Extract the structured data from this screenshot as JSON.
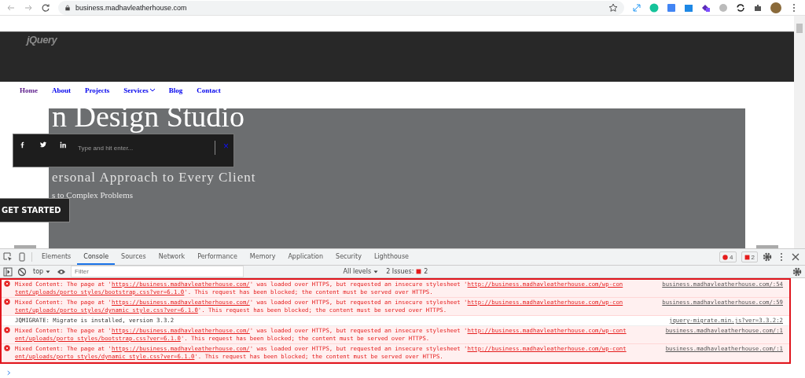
{
  "browser": {
    "url": "business.madhavleatherhouse.com"
  },
  "page": {
    "logo": "jQuery",
    "nav": [
      {
        "label": "Home",
        "visited": true,
        "kind": "link"
      },
      {
        "label": "About",
        "visited": false,
        "kind": "link"
      },
      {
        "label": "Projects",
        "visited": false,
        "kind": "link"
      },
      {
        "label": "Services",
        "visited": false,
        "kind": "dropdown"
      },
      {
        "label": "Blog",
        "visited": false,
        "kind": "link"
      },
      {
        "label": "Contact",
        "visited": false,
        "kind": "link"
      }
    ],
    "heading": "n Design Studio",
    "search": {
      "placeholder": "Type and hit enter...",
      "close": "×"
    },
    "subtitle": "ersonal Approach to Every Client",
    "tagline": "s to Complex Problems",
    "cta": "GET STARTED"
  },
  "devtools": {
    "tabs": [
      {
        "label": "Elements",
        "selected": false
      },
      {
        "label": "Console",
        "selected": true
      },
      {
        "label": "Sources",
        "selected": false
      },
      {
        "label": "Network",
        "selected": false
      },
      {
        "label": "Performance",
        "selected": false
      },
      {
        "label": "Memory",
        "selected": false
      },
      {
        "label": "Application",
        "selected": false
      },
      {
        "label": "Security",
        "selected": false
      },
      {
        "label": "Lighthouse",
        "selected": false
      }
    ],
    "error_count": "4",
    "issue_count": "2",
    "context": "top",
    "filter_placeholder": "Filter",
    "levels": "All levels",
    "issues_label": "2 Issues:",
    "issues_badge": "2",
    "messages": [
      {
        "kind": "error",
        "source": "business.madhavleatherhouse.com/:54",
        "lines": [
          [
            {
              "text": "Mixed Content: The page at '",
              "link": false
            },
            {
              "text": "https://business.madhavleatherhouse.com/",
              "link": true
            },
            {
              "text": "' was loaded over HTTPS, but requested an insecure stylesheet '",
              "link": false
            },
            {
              "text": "http://business.madhavleatherhouse.com/wp-con",
              "link": true
            }
          ],
          [
            {
              "text": "tent/uploads/porto_styles/bootstrap.css?ver=6.1.0",
              "link": true
            },
            {
              "text": "'. This request has been blocked; the content must be served over HTTPS.",
              "link": false
            }
          ]
        ]
      },
      {
        "kind": "error",
        "source": "business.madhavleatherhouse.com/:59",
        "lines": [
          [
            {
              "text": "Mixed Content: The page at '",
              "link": false
            },
            {
              "text": "https://business.madhavleatherhouse.com/",
              "link": true
            },
            {
              "text": "' was loaded over HTTPS, but requested an insecure stylesheet '",
              "link": false
            },
            {
              "text": "http://business.madhavleatherhouse.com/wp-con",
              "link": true
            }
          ],
          [
            {
              "text": "tent/uploads/porto_styles/dynamic_style.css?ver=6.1.0",
              "link": true
            },
            {
              "text": "'. This request has been blocked; the content must be served over HTTPS.",
              "link": false
            }
          ]
        ]
      },
      {
        "kind": "info",
        "source": "jquery-migrate.min.js?ver=3.3.2:2",
        "lines": [
          [
            {
              "text": "JQMIGRATE: Migrate is installed, version 3.3.2",
              "link": false
            }
          ]
        ]
      },
      {
        "kind": "error",
        "source": "business.madhavleatherhouse.com/:1",
        "lines": [
          [
            {
              "text": "Mixed Content: The page at '",
              "link": false
            },
            {
              "text": "https://business.madhavleatherhouse.com/",
              "link": true
            },
            {
              "text": "' was loaded over HTTPS, but requested an insecure stylesheet '",
              "link": false
            },
            {
              "text": "http://business.madhavleatherhouse.com/wp-cont",
              "link": true
            }
          ],
          [
            {
              "text": "ent/uploads/porto_styles/bootstrap.css?ver=6.1.0",
              "link": true
            },
            {
              "text": "'. This request has been blocked; the content must be served over HTTPS.",
              "link": false
            }
          ]
        ]
      },
      {
        "kind": "error",
        "source": "business.madhavleatherhouse.com/:1",
        "lines": [
          [
            {
              "text": "Mixed Content: The page at '",
              "link": false
            },
            {
              "text": "https://business.madhavleatherhouse.com/",
              "link": true
            },
            {
              "text": "' was loaded over HTTPS, but requested an insecure stylesheet '",
              "link": false
            },
            {
              "text": "http://business.madhavleatherhouse.com/wp-cont",
              "link": true
            }
          ],
          [
            {
              "text": "ent/uploads/porto_styles/dynamic_style.css?ver=6.1.0",
              "link": true
            },
            {
              "text": "'. This request has been blocked; the content must be served over HTTPS.",
              "link": false
            }
          ]
        ]
      }
    ]
  }
}
